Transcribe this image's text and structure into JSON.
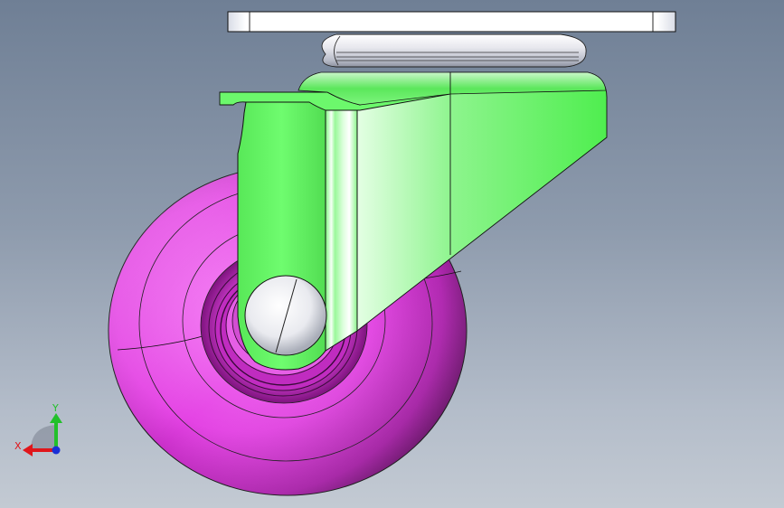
{
  "viewport": {
    "background_top": "#6f7f95",
    "background_bottom": "#c3cad3"
  },
  "model": {
    "wheel_color": "#e63de6",
    "bracket_color": "#5ef95e",
    "plate_color": "#ffffff",
    "axle_color": "#f2f2f2"
  },
  "triad": {
    "x_label": "X",
    "y_label": "Y",
    "x_color": "#e0161b",
    "y_color": "#22c02a",
    "z_color": "#1a2fd6"
  }
}
